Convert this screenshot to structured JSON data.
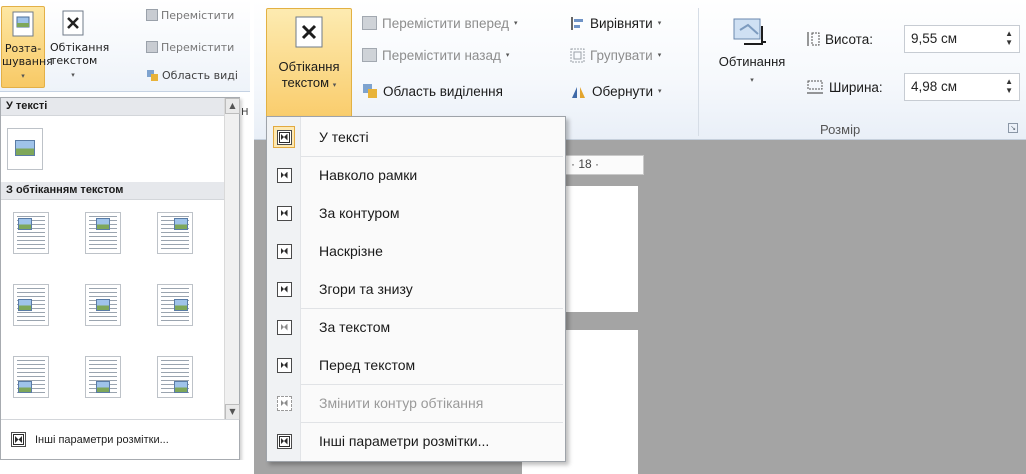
{
  "left": {
    "ribbon": {
      "position_button": {
        "line1": "Розта-",
        "line2": "шування",
        "arrow": "▾"
      },
      "wrap_button": {
        "line1": "Обтікання",
        "line2": "текстом",
        "arrow": "▾"
      },
      "small_items": [
        {
          "label": "Перемістити",
          "icon": "bring-forward-icon"
        },
        {
          "label": "Перемістити",
          "icon": "send-backward-icon"
        },
        {
          "label": "Область виді",
          "icon": "selection-pane-icon"
        }
      ],
      "cut_letter": "Н"
    },
    "gallery": {
      "section_inline": "У тексті",
      "section_wrap": "З обтіканням текстом",
      "scroll_up": "▲",
      "scroll_down": "▼",
      "footer_label": "Інші параметри розмітки..."
    }
  },
  "right": {
    "ribbon": {
      "wrap_button": {
        "line1": "Обтікання",
        "line2": "текстом",
        "arrow": "▾"
      },
      "arrange": [
        {
          "label": "Перемістити вперед",
          "arrow": "▾",
          "icon": "bring-forward-icon",
          "enabled": false
        },
        {
          "label": "Перемістити назад",
          "arrow": "▾",
          "icon": "send-backward-icon",
          "enabled": false
        },
        {
          "label": "Область виділення",
          "arrow": "",
          "icon": "selection-pane-icon",
          "enabled": true
        },
        {
          "label": "Вирівняти",
          "arrow": "▾",
          "icon": "align-icon",
          "enabled": true
        },
        {
          "label": "Групувати",
          "arrow": "▾",
          "icon": "group-icon",
          "enabled": false
        },
        {
          "label": "Обернути",
          "arrow": "▾",
          "icon": "rotate-icon",
          "enabled": true
        }
      ],
      "crop": {
        "label": "Обтинання",
        "arrow": "▾"
      },
      "size": {
        "height_label": "Висота:",
        "height_value": "9,55 см",
        "width_label": "Ширина:",
        "width_value": "4,98 см",
        "group_label": "Розмір",
        "spin": "▲▼"
      }
    },
    "ruler_text": "· 18 ·",
    "menu": {
      "items": [
        {
          "label": "У тексті",
          "icon": "wrap-inline-icon",
          "checked": true,
          "enabled": true
        },
        {
          "label": "Навколо рамки",
          "icon": "wrap-square-icon",
          "checked": false,
          "enabled": true
        },
        {
          "label": "За контуром",
          "icon": "wrap-tight-icon",
          "checked": false,
          "enabled": true
        },
        {
          "label": "Наскрізне",
          "icon": "wrap-through-icon",
          "checked": false,
          "enabled": true
        },
        {
          "label": "Згори та знизу",
          "icon": "wrap-top-bottom-icon",
          "checked": false,
          "enabled": true
        },
        {
          "label": "За текстом",
          "icon": "wrap-behind-text-icon",
          "checked": false,
          "enabled": true
        },
        {
          "label": "Перед текстом",
          "icon": "wrap-in-front-icon",
          "checked": false,
          "enabled": true
        },
        {
          "label": "Змінити контур обтікання",
          "icon": "edit-wrap-points-icon",
          "checked": false,
          "enabled": false
        },
        {
          "label": "Інші параметри розмітки...",
          "icon": "layout-options-icon",
          "checked": false,
          "enabled": true
        }
      ]
    }
  },
  "colors": {
    "active_button_top": "#fde7a3",
    "active_button_bottom": "#f8c965",
    "workspace": "#a4a4a4",
    "disabled_text": "#9a9a9a"
  }
}
